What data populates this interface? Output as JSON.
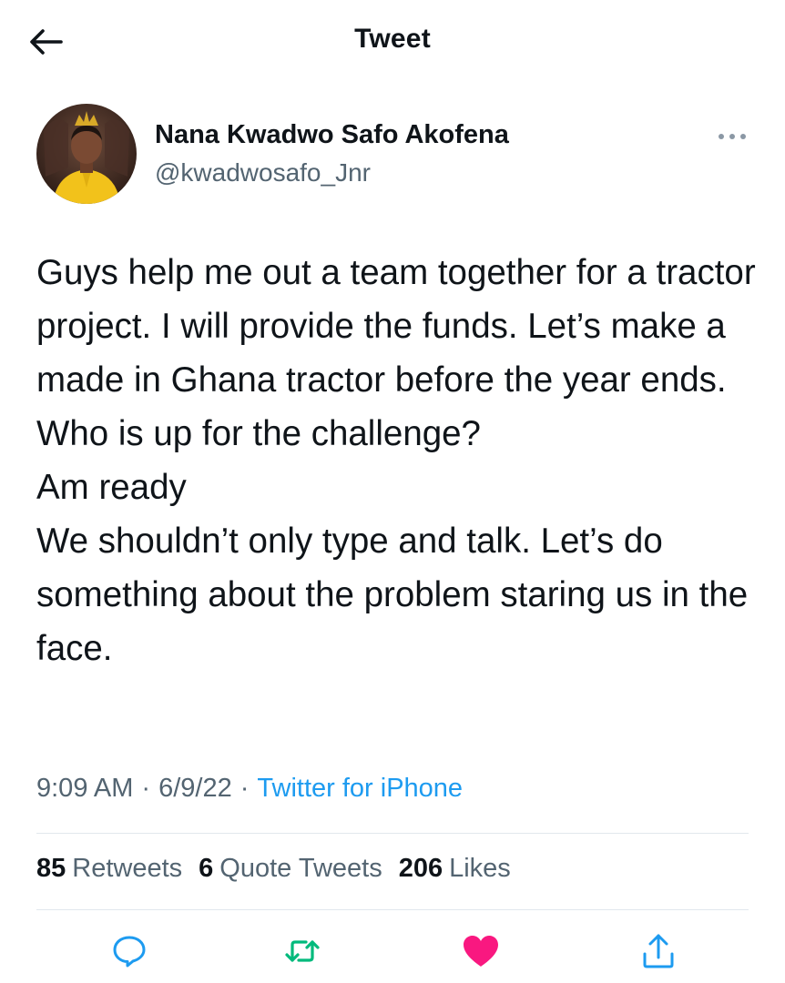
{
  "header": {
    "title": "Tweet"
  },
  "author": {
    "name": "Nana Kwadwo Safo Akofena",
    "handle": "@kwadwosafo_Jnr"
  },
  "tweet": {
    "text": "Guys help me out a team together for a tractor project. I will provide the funds. Let’s make a made in Ghana tractor before the year ends. Who is up for the challenge?\nAm ready\nWe shouldn’t only type and talk. Let’s do something about the problem staring us in the face.",
    "time": "9:09 AM",
    "date": "6/9/22",
    "separator": "·",
    "source": "Twitter for iPhone"
  },
  "stats": {
    "retweets_count": "85",
    "retweets_label": "Retweets",
    "quotes_count": "6",
    "quotes_label": "Quote Tweets",
    "likes_count": "206",
    "likes_label": "Likes"
  },
  "colors": {
    "text": "#0f1419",
    "muted": "#536471",
    "link": "#1d9bf0",
    "retweet_green": "#00ba7c",
    "like_pink": "#f91880",
    "icon_blue": "#1d9bf0",
    "divider": "#e1e8ed"
  },
  "icons": {
    "back": "arrow-left-icon",
    "more": "more-dots-icon",
    "reply": "reply-icon",
    "retweet": "retweet-icon",
    "like": "heart-icon",
    "share": "share-icon"
  }
}
